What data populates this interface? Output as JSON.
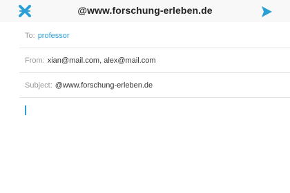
{
  "navbar": {
    "title": "@www.forschung-erleben.de",
    "close_icon": "close-x-icon",
    "send_icon": "send-arrow-icon",
    "accent_color": "#2a9fd6"
  },
  "fields": {
    "to": {
      "label": "To:",
      "value": "professor"
    },
    "from": {
      "label": "From:",
      "value": "xian@mail.com, alex@mail.com"
    },
    "subject": {
      "label": "Subject:",
      "value": "@www.forschung-erleben.de"
    }
  },
  "body": {
    "value": ""
  }
}
